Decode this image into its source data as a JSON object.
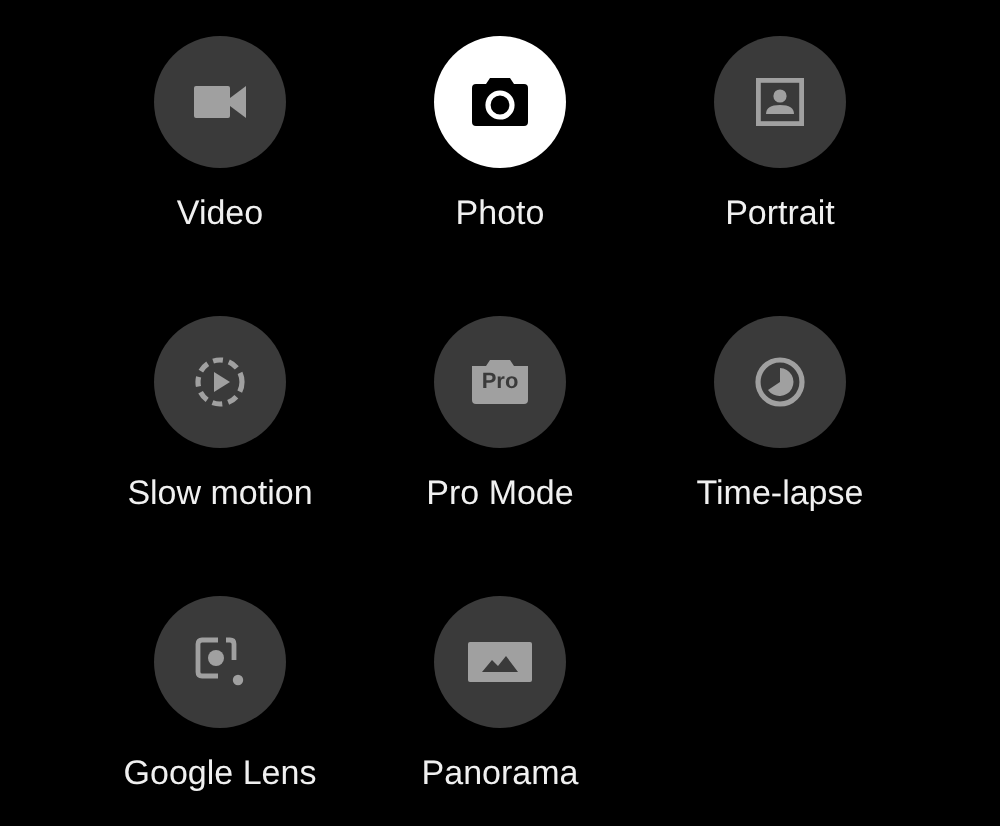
{
  "modes": [
    {
      "label": "Video",
      "selected": false
    },
    {
      "label": "Photo",
      "selected": true
    },
    {
      "label": "Portrait",
      "selected": false
    },
    {
      "label": "Slow motion",
      "selected": false
    },
    {
      "label": "Pro Mode",
      "badge": "Pro",
      "selected": false
    },
    {
      "label": "Time-lapse",
      "selected": false
    },
    {
      "label": "Google Lens",
      "selected": false
    },
    {
      "label": "Panorama",
      "selected": false
    }
  ]
}
